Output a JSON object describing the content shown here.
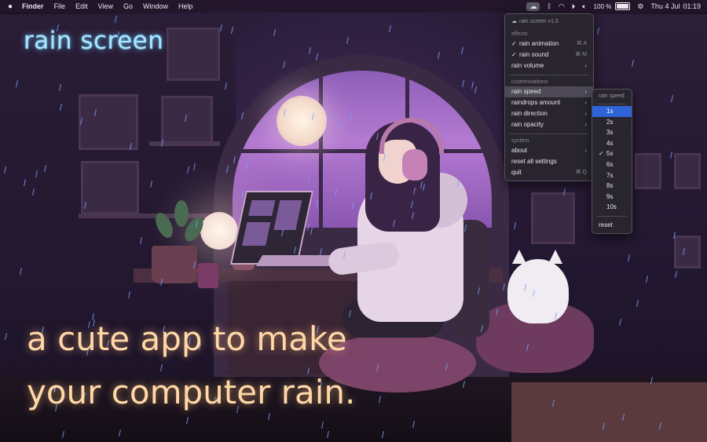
{
  "menubar": {
    "apple_icon": "apple-icon",
    "items": [
      "Finder",
      "File",
      "Edit",
      "View",
      "Go",
      "Window",
      "Help"
    ],
    "battery_percent": "100 %",
    "battery_label": "⚡",
    "date": "Thu 4 Jul",
    "time": "01:19",
    "icons": [
      "rain-screen-icon",
      "bluetooth-icon",
      "wifi-icon",
      "play-icon",
      "volume-icon",
      "control-center-icon"
    ]
  },
  "overlay": {
    "title": "rain screen",
    "tagline_line1": "a cute app to make",
    "tagline_line2": "your computer rain."
  },
  "menu": {
    "header": "rain screen v1.0",
    "sections": {
      "effects": "effects",
      "customisations": "customisations",
      "system": "system"
    },
    "items": {
      "rain_animation": {
        "label": "rain animation",
        "shortcut": "⌘ A",
        "checked": true
      },
      "rain_sound": {
        "label": "rain sound",
        "shortcut": "⌘ M",
        "checked": true
      },
      "rain_volume": {
        "label": "rain volume"
      },
      "rain_speed": {
        "label": "rain speed"
      },
      "raindrops_amount": {
        "label": "raindrops amount"
      },
      "rain_direction": {
        "label": "rain direction"
      },
      "rain_opacity": {
        "label": "rain opacity"
      },
      "about": {
        "label": "about"
      },
      "reset_all": {
        "label": "reset all settings"
      },
      "quit": {
        "label": "quit",
        "shortcut": "⌘ Q"
      }
    }
  },
  "submenu": {
    "header": "rain speed",
    "options": [
      "1s",
      "2s",
      "3s",
      "4s",
      "5s",
      "6s",
      "7s",
      "8s",
      "9s",
      "10s"
    ],
    "checked": "5s",
    "highlighted": "1s",
    "reset": "reset"
  },
  "colors": {
    "title_glow": "#a9e6ff",
    "tagline": "#ffd8a8",
    "selection": "#2f63d8",
    "rain": "#78a0ff"
  }
}
